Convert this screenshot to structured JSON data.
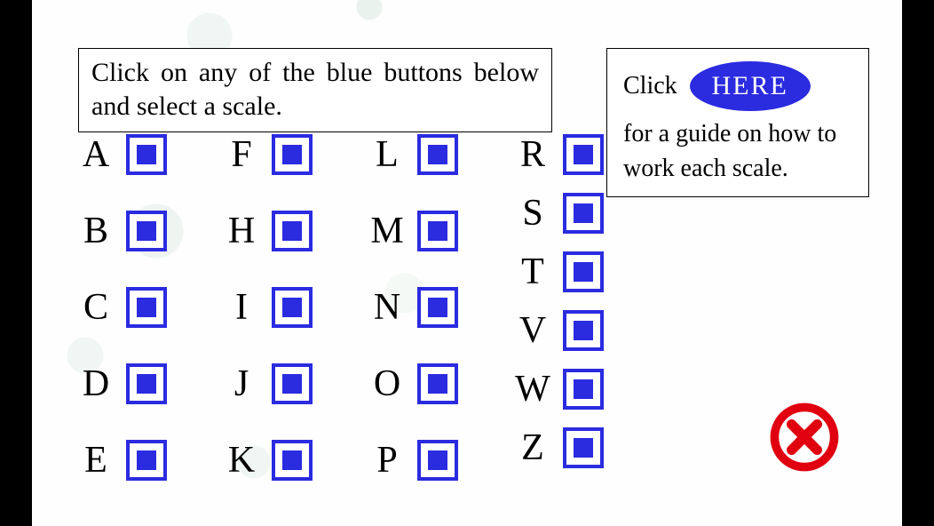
{
  "instruction": "Click on any of the blue buttons below and select a scale.",
  "guide": {
    "click_label": "Click",
    "here_label": "HERE",
    "rest": "for a guide on how to work each scale."
  },
  "columns": [
    [
      "A",
      "B",
      "C",
      "D",
      "E"
    ],
    [
      "F",
      "H",
      "I",
      "J",
      "K"
    ],
    [
      "L",
      "M",
      "N",
      "O",
      "P"
    ],
    [
      "R",
      "S",
      "T",
      "V",
      "W",
      "Z"
    ]
  ],
  "colors": {
    "blue": "#2b2be0",
    "red": "#e00010"
  }
}
